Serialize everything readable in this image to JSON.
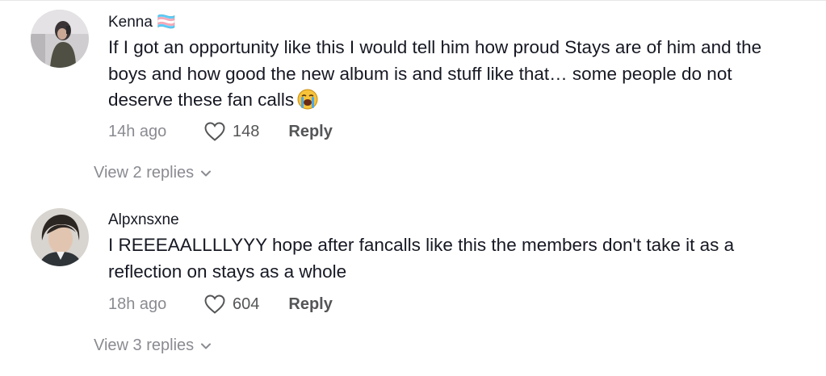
{
  "comments": [
    {
      "username": "Kenna 🏳️‍⚧️",
      "username_glyph": "🏳️‍⚧️",
      "text": "If I got an opportunity like this I would tell him how proud Stays are of him and the boys and how good the new album is and stuff like that… some people do not deserve these fan calls",
      "emoji": "loudly-crying-face-icon",
      "time": "14h ago",
      "likes": "148",
      "reply_label": "Reply",
      "view_replies": "View 2 replies"
    },
    {
      "username": "Alpxnsxne",
      "text": "I REEEAALLLLYYY hope after fancalls like this the members don't take it as a reflection on stays as a whole",
      "time": "18h ago",
      "likes": "604",
      "reply_label": "Reply",
      "view_replies": "View 3 replies"
    }
  ],
  "colors": {
    "primary_text": "#161823",
    "secondary_text": "#8a8b91",
    "action_text": "#545557"
  }
}
